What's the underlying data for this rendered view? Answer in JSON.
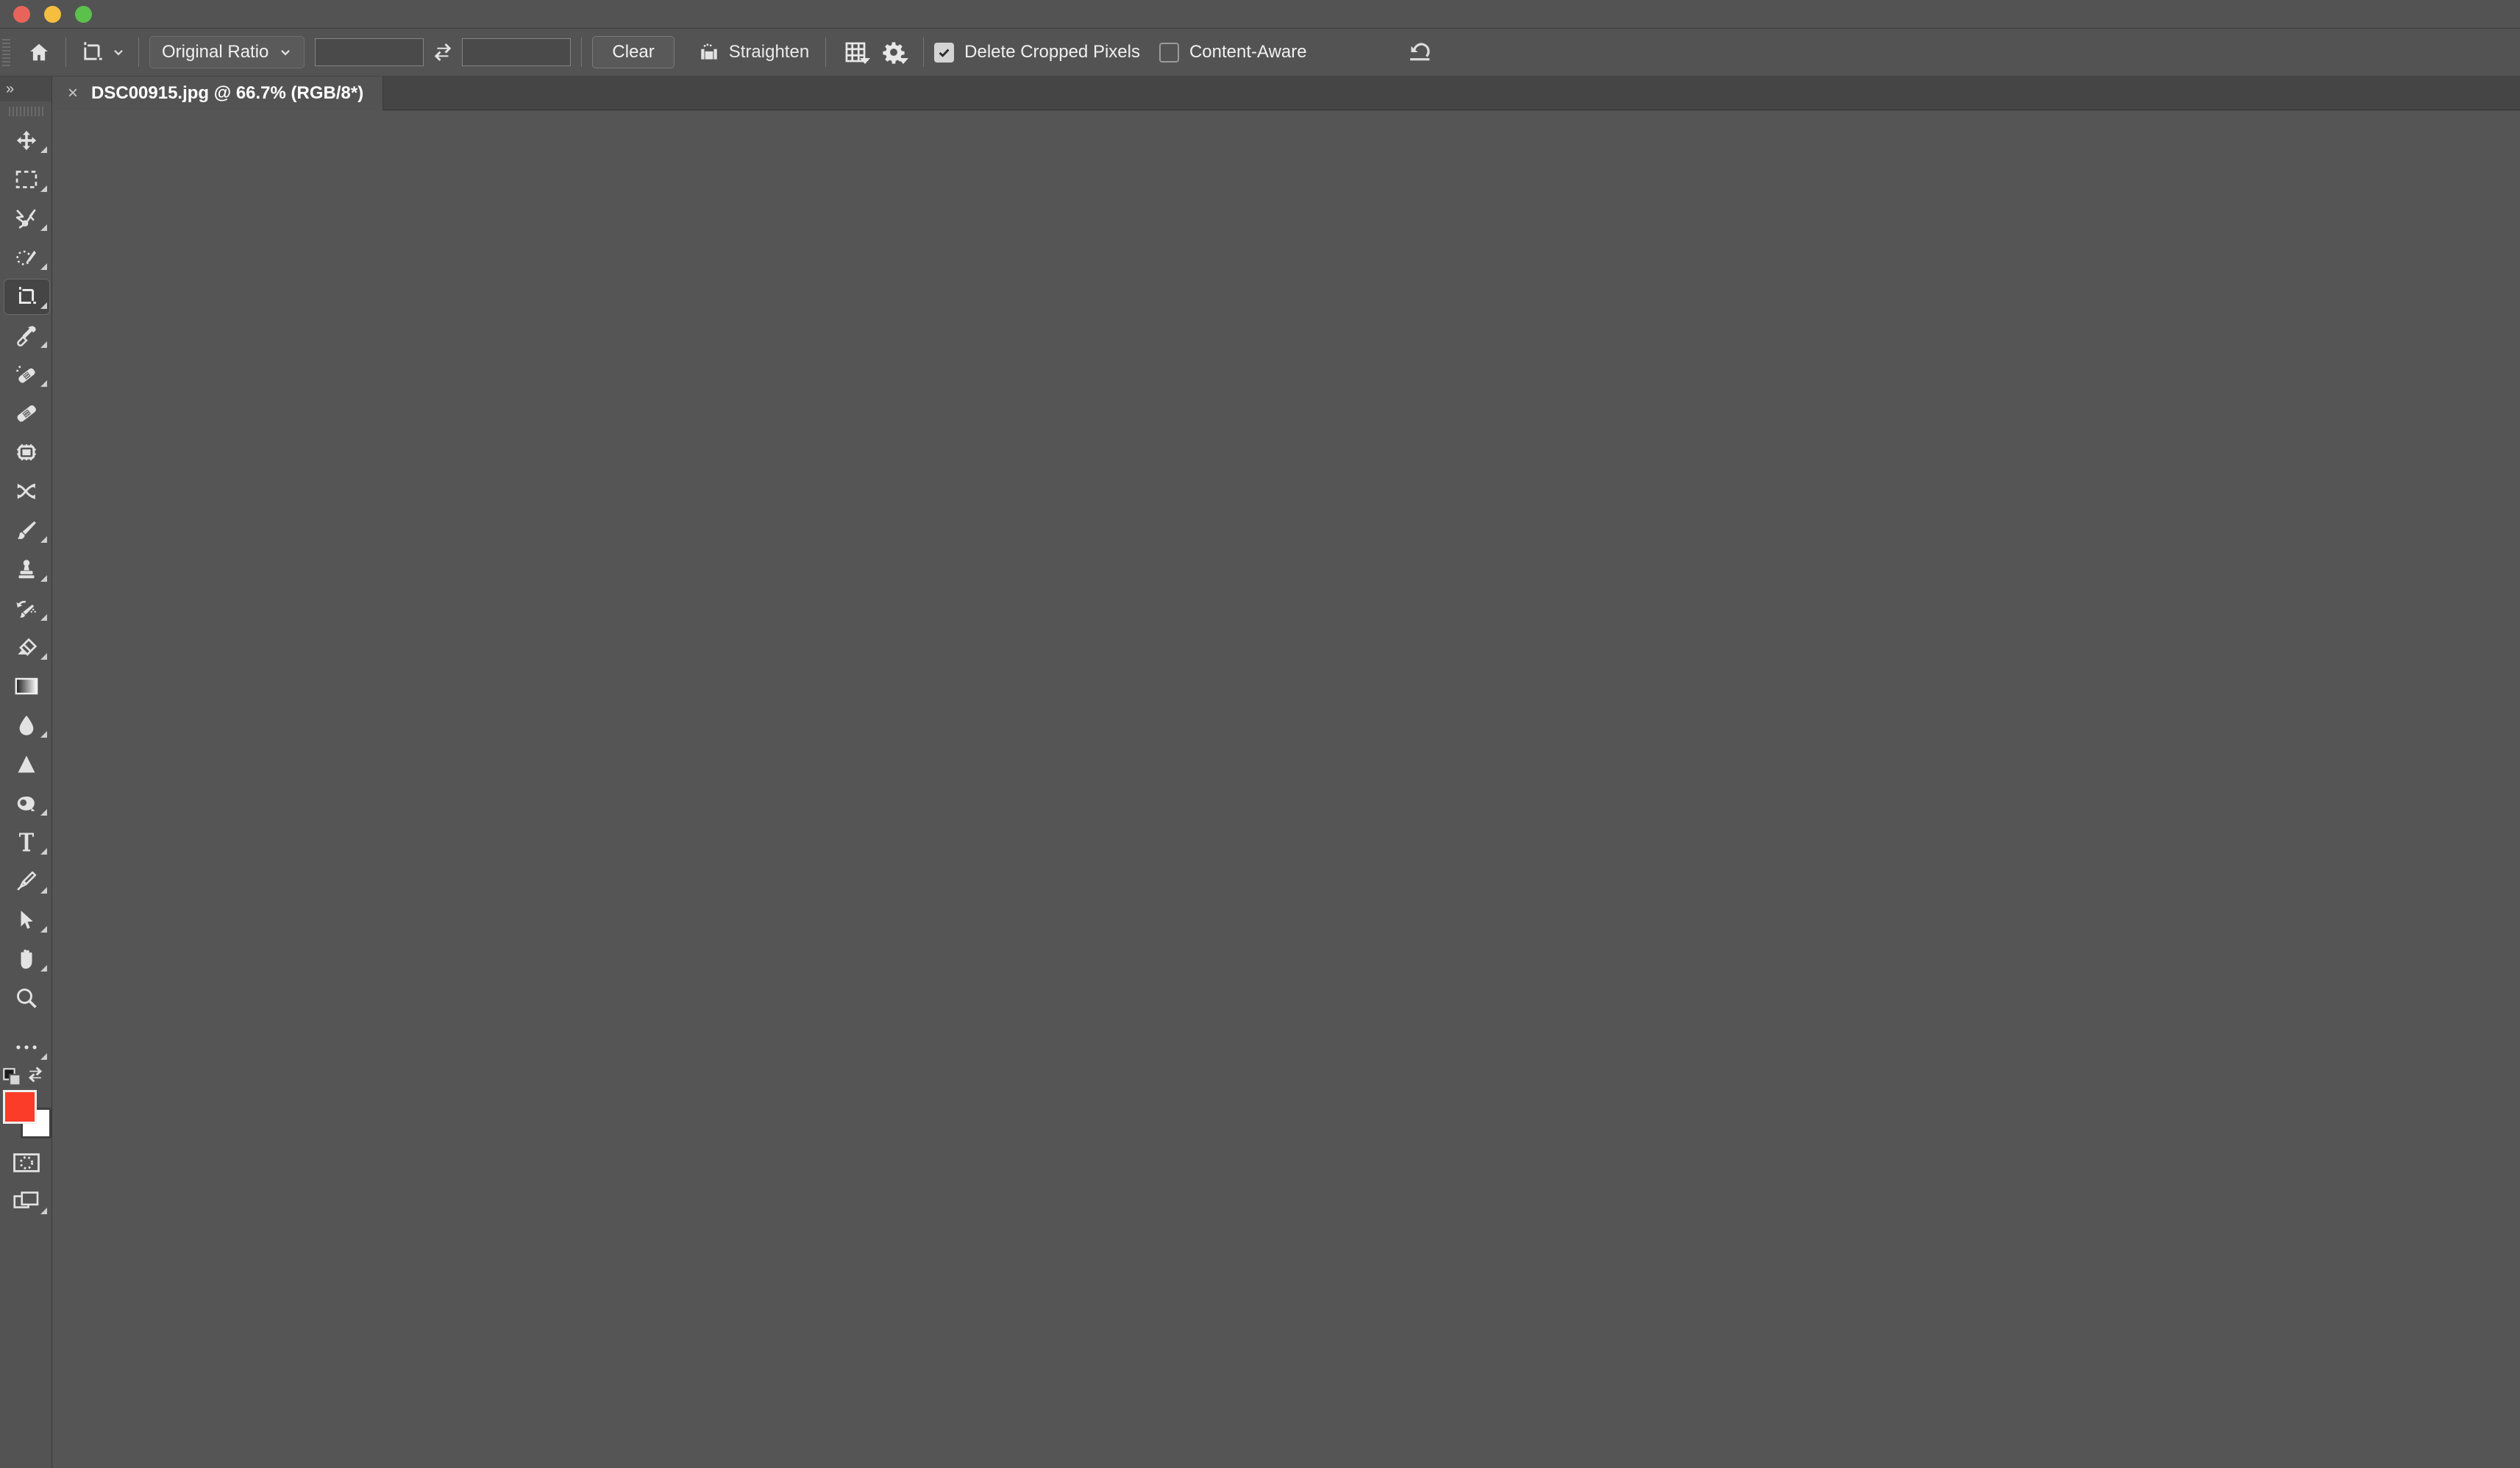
{
  "window": {
    "traffic_lights": [
      {
        "name": "close",
        "color": "#e8645a"
      },
      {
        "name": "minimize",
        "color": "#f5be3f"
      },
      {
        "name": "maximize",
        "color": "#5cc04c"
      }
    ]
  },
  "options_bar": {
    "home_icon": "home-icon",
    "tool_icon": "crop-tool-icon",
    "tool_preset_chevron": "chevron-down-icon",
    "ratio": {
      "label": "Original Ratio",
      "chevron": "chevron-down-icon",
      "width_value": "",
      "width_placeholder": "",
      "height_value": "",
      "height_placeholder": "",
      "swap_icon": "swap-arrows-icon"
    },
    "clear_label": "Clear",
    "straighten_label": "Straighten",
    "straighten_icon": "straighten-icon",
    "overlay_icon": "grid-overlay-icon",
    "settings_icon": "gear-icon",
    "delete_cropped_pixels": {
      "label": "Delete Cropped Pixels",
      "checked": true
    },
    "content_aware": {
      "label": "Content-Aware",
      "checked": false
    },
    "reset_icon": "reset-undo-icon"
  },
  "tabs": {
    "documents": [
      {
        "title": "DSC00915.jpg @ 66.7% (RGB/8*)",
        "close": "×",
        "active": true
      }
    ]
  },
  "tool_panel": {
    "expand_label": "»",
    "tools": [
      {
        "name": "move-tool",
        "icon": "move-icon",
        "active": false,
        "has_submenu": true
      },
      {
        "name": "rectangular-marquee",
        "icon": "marquee-icon",
        "active": false,
        "has_submenu": true
      },
      {
        "name": "lasso-tool",
        "icon": "lasso-icon",
        "active": false,
        "has_submenu": true
      },
      {
        "name": "object-selection-tool",
        "icon": "quick-select-icon",
        "active": false,
        "has_submenu": true
      },
      {
        "name": "crop-tool",
        "icon": "crop-icon",
        "active": true,
        "has_submenu": true
      },
      {
        "name": "eyedropper-tool",
        "icon": "eyedropper-icon",
        "active": false,
        "has_submenu": true
      },
      {
        "name": "spot-healing-brush",
        "icon": "spot-healing-icon",
        "active": false,
        "has_submenu": true
      },
      {
        "name": "healing-brush",
        "icon": "bandage-icon",
        "active": false,
        "has_submenu": false
      },
      {
        "name": "remove-tool",
        "icon": "remove-tool-icon",
        "active": false,
        "has_submenu": false
      },
      {
        "name": "shuffle-tool",
        "icon": "shuffle-icon",
        "active": false,
        "has_submenu": false
      },
      {
        "name": "brush-tool",
        "icon": "brush-icon",
        "active": false,
        "has_submenu": true
      },
      {
        "name": "clone-stamp-tool",
        "icon": "stamp-icon",
        "active": false,
        "has_submenu": true
      },
      {
        "name": "history-brush-tool",
        "icon": "history-brush-icon",
        "active": false,
        "has_submenu": true
      },
      {
        "name": "eraser-tool",
        "icon": "eraser-icon",
        "active": false,
        "has_submenu": true
      },
      {
        "name": "gradient-tool",
        "icon": "gradient-icon",
        "active": false,
        "has_submenu": true
      },
      {
        "name": "blur-tool",
        "icon": "blur-droplet-icon",
        "active": false,
        "has_submenu": true
      },
      {
        "name": "dodge-tool",
        "icon": "dodge-cone-icon",
        "active": false,
        "has_submenu": false
      },
      {
        "name": "sponge-tool",
        "icon": "sponge-icon",
        "active": false,
        "has_submenu": true
      },
      {
        "name": "type-tool",
        "icon": "text-t-icon",
        "active": false,
        "has_submenu": true
      },
      {
        "name": "pen-tool",
        "icon": "pen-nib-icon",
        "active": false,
        "has_submenu": true
      },
      {
        "name": "path-selection-tool",
        "icon": "path-arrow-icon",
        "active": false,
        "has_submenu": true
      },
      {
        "name": "hand-tool",
        "icon": "hand-icon",
        "active": false,
        "has_submenu": true
      },
      {
        "name": "zoom-tool",
        "icon": "magnifier-icon",
        "active": false,
        "has_submenu": false
      },
      {
        "name": "edit-toolbar",
        "icon": "ellipsis-icon",
        "active": false,
        "has_submenu": true
      }
    ],
    "colors": {
      "foreground": "#fa3c28",
      "background": "#ffffff",
      "default_icon": "default-colors-icon",
      "swap_icon": "swap-colors-icon"
    },
    "bottom_tools": [
      {
        "name": "quick-mask-mode",
        "icon": "quick-mask-icon",
        "has_submenu": false
      },
      {
        "name": "screen-mode",
        "icon": "screen-mode-icon",
        "has_submenu": true
      }
    ]
  },
  "canvas": {
    "background": "#555555"
  }
}
